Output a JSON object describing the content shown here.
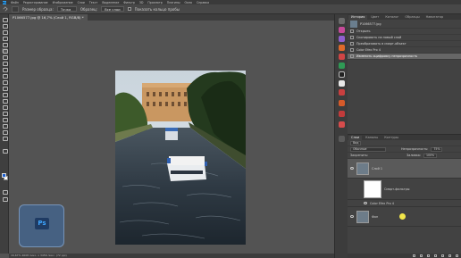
{
  "menu": {
    "app": "Ps",
    "items": [
      "Файл",
      "Редактирование",
      "Изображение",
      "Слои",
      "Текст",
      "Выделение",
      "Фильтр",
      "3D",
      "Просмотр",
      "Плагины",
      "Окно",
      "Справка"
    ]
  },
  "options": {
    "sample_size_label": "Размер образца:",
    "sample_size_value": "Точка",
    "sample_label": "Образец:",
    "sample_value": "Все слои",
    "show_ring_label": "Показать кольцо пробы"
  },
  "document": {
    "tab_title": "P1066577.jpg @ 16,7% (Слой 1, RGB/8) *",
    "status": "16,67%  4608 пикс. x 3456 пикс. (72 ppi)"
  },
  "history": {
    "tabs": [
      "История",
      "Цвет",
      "Каталог",
      "Образцы",
      "Навигатор"
    ],
    "snapshot": "P1066577.jpg",
    "items": [
      "Открыть",
      "Скопировать на новый слой",
      "Преобразовать в смарт-объект",
      "Color Efex Pro 4",
      "Изменить оцифровку непрозрачность"
    ]
  },
  "layers": {
    "tabs": [
      "Слои",
      "Каналы",
      "Контуры"
    ],
    "filter_label": "Вид",
    "blend_mode": "Обычные",
    "opacity_label": "Непрозрачность:",
    "opacity_value": "75%",
    "lock_label": "Закрепить:",
    "fill_label": "Заливка:",
    "fill_value": "100%",
    "layer1_name": "Слой 1",
    "smart_filters_label": "Смарт-фильтры",
    "filter_name": "Color Efex Pro 4",
    "background_name": "Фон"
  },
  "watermark_text": "Ps"
}
